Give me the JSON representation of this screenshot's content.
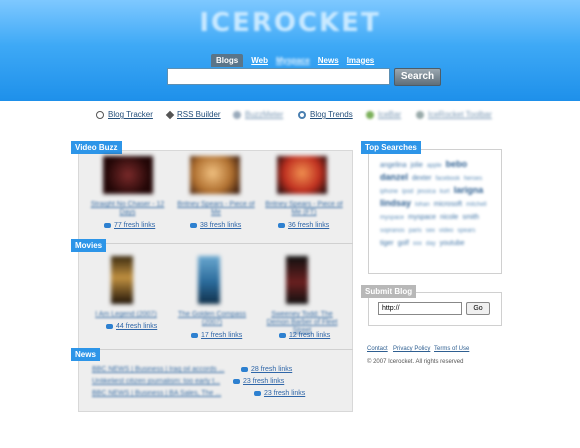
{
  "header": {
    "logo": "ICEROCKET",
    "tabs": [
      "Blogs",
      "Web",
      "Myspace",
      "News",
      "Images"
    ],
    "search_button": "Search",
    "search_value": ""
  },
  "toolbar": {
    "links": [
      "Blog Tracker",
      "RSS Builder",
      "BuzzMeter",
      "Blog Trends",
      "IceBar",
      "IceRocket Toolbar"
    ]
  },
  "video_buzz": {
    "label": "Video Buzz",
    "items": [
      {
        "caption": "Straight No Chaser - 12 Days",
        "links": "77 fresh links"
      },
      {
        "caption": "Britney Spears - Piece of Me",
        "links": "38 fresh links"
      },
      {
        "caption": "Britney Spears - Piece of Me (FT)",
        "links": "36 fresh links"
      }
    ]
  },
  "movies": {
    "label": "Movies",
    "items": [
      {
        "caption": "I Am Legend (2007)",
        "links": "44 fresh links"
      },
      {
        "caption": "The Golden Compass (2007)",
        "links": "17 fresh links"
      },
      {
        "caption": "Sweeney Todd: The Demon Barber of Fleet Street",
        "links": "12 fresh links"
      }
    ]
  },
  "news": {
    "label": "News",
    "items": [
      {
        "title": "BBC NEWS | Business | Iraq oil accords ...",
        "links": "28 fresh links"
      },
      {
        "title": "Unlikeliest citizen journalism: too early t...",
        "links": "23 fresh links"
      },
      {
        "title": "BBC NEWS | Business | BA Sales, The ...",
        "links": "23 fresh links"
      }
    ]
  },
  "top_searches": {
    "label": "Top Searches",
    "terms": [
      {
        "t": "angelina",
        "w": "m"
      },
      {
        "t": "jolie",
        "w": "m"
      },
      {
        "t": "apple",
        "w": "s"
      },
      {
        "t": "bebo",
        "w": "b"
      },
      {
        "t": "danzel",
        "w": "b"
      },
      {
        "t": "dexter",
        "w": "m"
      },
      {
        "t": "facebook",
        "w": "s"
      },
      {
        "t": "heroes",
        "w": "s"
      },
      {
        "t": "iphone",
        "w": "s"
      },
      {
        "t": "ipod",
        "w": "s"
      },
      {
        "t": "jessica",
        "w": "s"
      },
      {
        "t": "kurt",
        "w": "s"
      },
      {
        "t": "larigna",
        "w": "b"
      },
      {
        "t": "lindsay",
        "w": "b"
      },
      {
        "t": "lohan",
        "w": "s"
      },
      {
        "t": "microsoft",
        "w": "m"
      },
      {
        "t": "mitchell",
        "w": "s"
      },
      {
        "t": "myspace",
        "w": "s"
      },
      {
        "t": "myspace",
        "w": "m"
      },
      {
        "t": "nicole",
        "w": "m"
      },
      {
        "t": "smith",
        "w": "m"
      },
      {
        "t": "sopranos",
        "w": "s"
      },
      {
        "t": "paris",
        "w": "s"
      },
      {
        "t": "sex",
        "w": "s"
      },
      {
        "t": "video",
        "w": "s"
      },
      {
        "t": "spears",
        "w": "s"
      },
      {
        "t": "tiger",
        "w": "m"
      },
      {
        "t": "golf",
        "w": "m"
      },
      {
        "t": "xxx",
        "w": "s"
      },
      {
        "t": "day",
        "w": "s"
      },
      {
        "t": "youtube",
        "w": "m"
      }
    ]
  },
  "submit_blog": {
    "label": "Submit Blog",
    "url_value": "http://",
    "go": "Go"
  },
  "footer": {
    "links": [
      "Contact",
      "Privacy Policy",
      "Terms of Use"
    ],
    "copyright": "© 2007 Icerocket.  All rights reserved"
  },
  "colors": {
    "header_top": "#7ec8ff",
    "header_bottom": "#1e90ea",
    "section_label": "#2d95e8",
    "link": "#2f66a8"
  }
}
